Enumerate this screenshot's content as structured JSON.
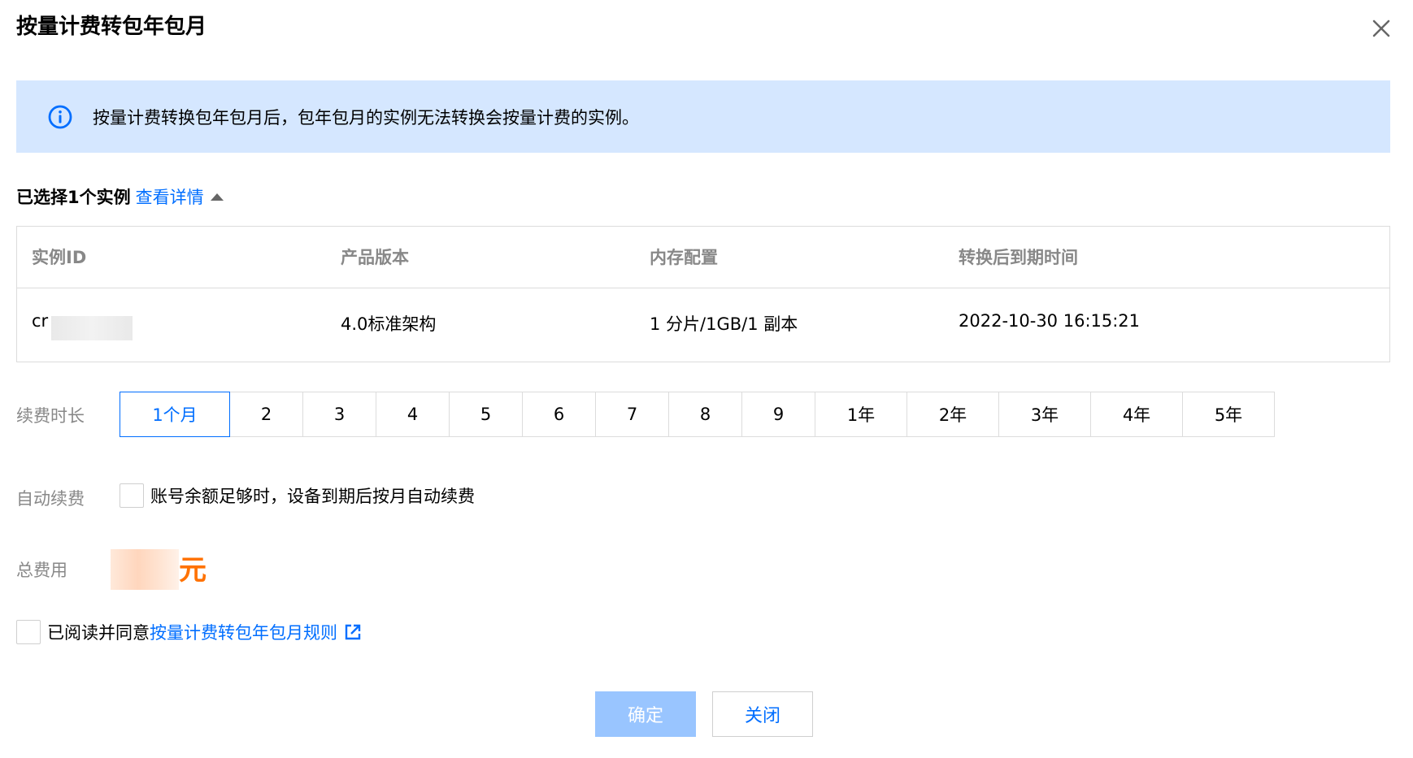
{
  "dialog": {
    "title": "按量计费转包年包月"
  },
  "notice": {
    "text": "按量计费转换包年包月后，包年包月的实例无法转换会按量计费的实例。"
  },
  "selection": {
    "label": "已选择1个实例",
    "detail_link": "查看详情"
  },
  "table": {
    "headers": [
      "实例ID",
      "产品版本",
      "内存配置",
      "转换后到期时间"
    ],
    "row": {
      "id_prefix": "cr",
      "version": "4.0标准架构",
      "memory": "1 分片/1GB/1 副本",
      "expire": "2022-10-30 16:15:21"
    }
  },
  "renew": {
    "label": "续费时长",
    "options": [
      "1个月",
      "2",
      "3",
      "4",
      "5",
      "6",
      "7",
      "8",
      "9",
      "1年",
      "2年",
      "3年",
      "4年",
      "5年"
    ],
    "selected": "1个月"
  },
  "auto_renew": {
    "label": "自动续费",
    "text": "账号余额足够时，设备到期后按月自动续费",
    "checked": false
  },
  "total": {
    "label": "总费用",
    "unit": "元"
  },
  "agreement": {
    "text": "已阅读并同意",
    "link": "按量计费转包年包月规则",
    "checked": false
  },
  "buttons": {
    "confirm": "确定",
    "close": "关闭"
  },
  "colors": {
    "primary": "#006eff",
    "notice_bg": "#d5e7ff",
    "price": "#ff7200",
    "confirm_disabled": "#99c5ff"
  },
  "icons": {
    "close": "close-icon",
    "info": "info-icon",
    "external": "external-link-icon",
    "caret": "caret-up-icon"
  }
}
